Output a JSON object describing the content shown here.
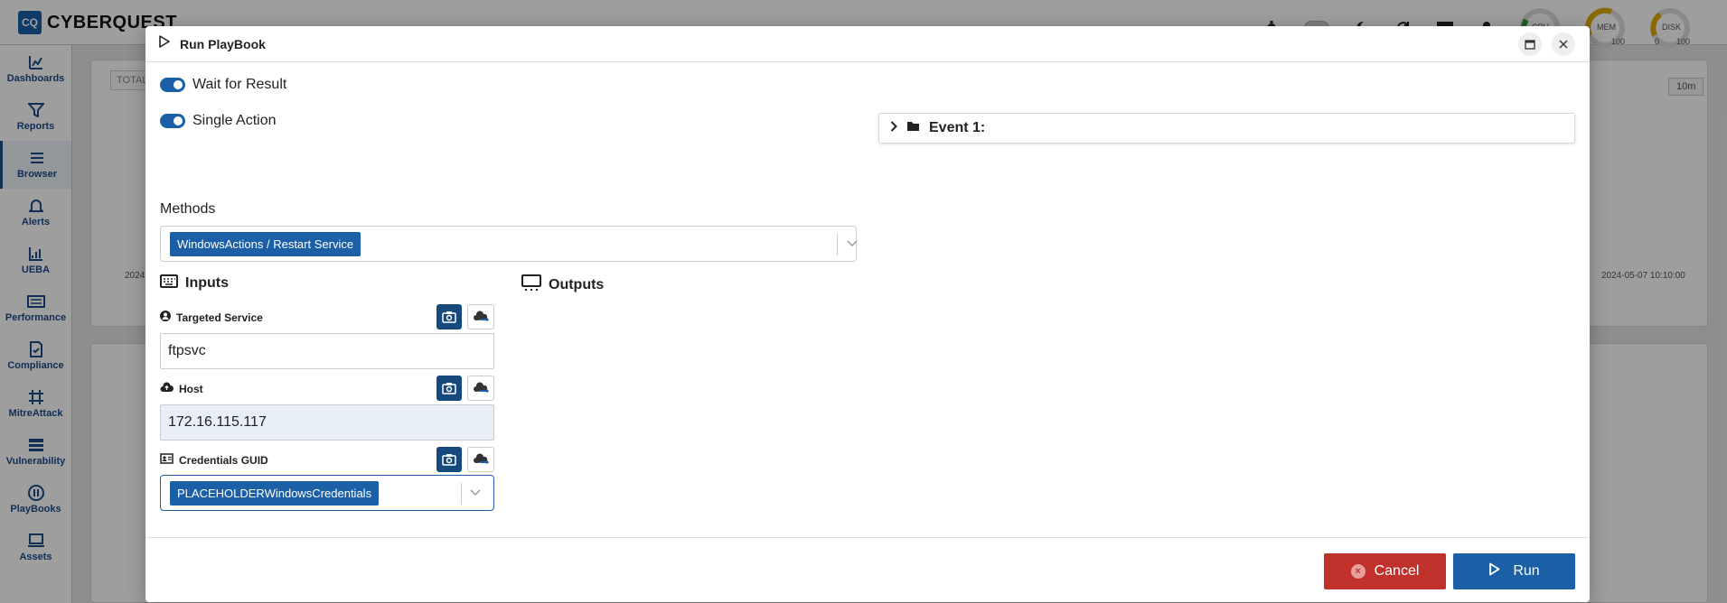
{
  "app": {
    "logo_abbr": "CQ",
    "logo_name": "CYBERQUEST"
  },
  "topbar": {
    "icons": [
      "gear-icon",
      "theme-toggle",
      "moon-icon",
      "refresh-icon",
      "calendar-icon",
      "user-icon"
    ],
    "gauges": [
      {
        "label": "CPU",
        "min": "",
        "max": "",
        "color": "#2e9e44"
      },
      {
        "label": "MEM",
        "min": "",
        "max": "100",
        "color": "#e0a800"
      },
      {
        "label": "DISK",
        "min": "0",
        "max": "100",
        "color": "#e0a800"
      }
    ]
  },
  "sidebar": {
    "items": [
      {
        "label": "Dashboards",
        "icon": "dashboard-icon"
      },
      {
        "label": "Reports",
        "icon": "funnel-icon"
      },
      {
        "label": "Browser",
        "icon": "list-icon"
      },
      {
        "label": "Alerts",
        "icon": "bell-icon"
      },
      {
        "label": "UEBA",
        "icon": "chart-line-icon"
      },
      {
        "label": "Performance",
        "icon": "keyboard-icon"
      },
      {
        "label": "Compliance",
        "icon": "document-check-icon"
      },
      {
        "label": "MitreAttack",
        "icon": "network-icon"
      },
      {
        "label": "Vulnerability",
        "icon": "layers-icon"
      },
      {
        "label": "PlayBooks",
        "icon": "playbook-icon"
      },
      {
        "label": "Assets",
        "icon": "laptop-icon"
      }
    ],
    "active_index": 2
  },
  "background": {
    "tab_label": "TOTAL",
    "range_label": "10m",
    "ts_left": "2024",
    "ts_right": "2024-05-07 10:10:00"
  },
  "modal": {
    "title": "Run PlayBook",
    "wait_for_result": {
      "label": "Wait for Result",
      "on": true
    },
    "single_action": {
      "label": "Single Action",
      "on": true
    },
    "methods": {
      "label": "Methods",
      "selected": "WindowsActions / Restart Service"
    },
    "inputs_title": "Inputs",
    "outputs_title": "Outputs",
    "fields": {
      "targeted_service": {
        "label": "Targeted Service",
        "value": "ftpsvc"
      },
      "host": {
        "label": "Host",
        "value": "172.16.115.117"
      },
      "credentials": {
        "label": "Credentials GUID",
        "selected": "PLACEHOLDERWindowsCredentials"
      }
    },
    "event": {
      "label": "Event 1:"
    },
    "footer": {
      "cancel_label": "Cancel",
      "run_label": "Run"
    }
  },
  "colors": {
    "primary": "#1b5fa6",
    "primary_dark": "#164a7d",
    "danger": "#c0312c"
  }
}
